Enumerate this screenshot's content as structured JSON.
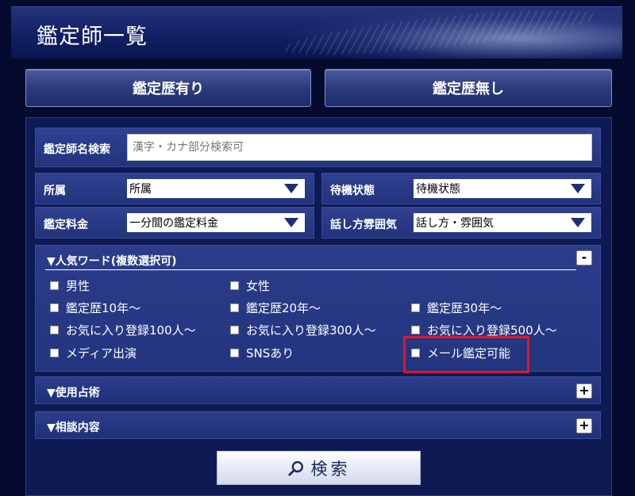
{
  "header": {
    "title": "鑑定師一覧"
  },
  "tabs": {
    "with_history": "鑑定歴有り",
    "without_history": "鑑定歴無し"
  },
  "search_form": {
    "name_search": {
      "label": "鑑定師名検索",
      "placeholder": "漢字・カナ部分検索可",
      "value": ""
    },
    "affiliation": {
      "label": "所属",
      "selected": "所属"
    },
    "standby": {
      "label": "待機状態",
      "selected": "待機状態"
    },
    "fee": {
      "label": "鑑定料金",
      "selected": "一分間の鑑定料金"
    },
    "atmosphere": {
      "label": "話し方雰囲気",
      "selected": "話し方・雰囲気"
    }
  },
  "popular": {
    "title": "▼人気ワード(複数選択可)",
    "toggle": "-",
    "options": [
      "男性",
      "女性",
      "鑑定歴10年～",
      "鑑定歴20年～",
      "鑑定歴30年～",
      "お気に入り登録100人～",
      "お気に入り登録300人～",
      "お気に入り登録500人～",
      "メディア出演",
      "SNSあり",
      "メール鑑定可能"
    ]
  },
  "sections": {
    "divination": {
      "title": "▼使用占術",
      "toggle": "+"
    },
    "consultation": {
      "title": "▼相談内容",
      "toggle": "+"
    }
  },
  "search_button": {
    "label": "検索"
  },
  "colors": {
    "background": "#040b2e",
    "panel": "#0d1a54",
    "highlight": "#e0162b"
  }
}
